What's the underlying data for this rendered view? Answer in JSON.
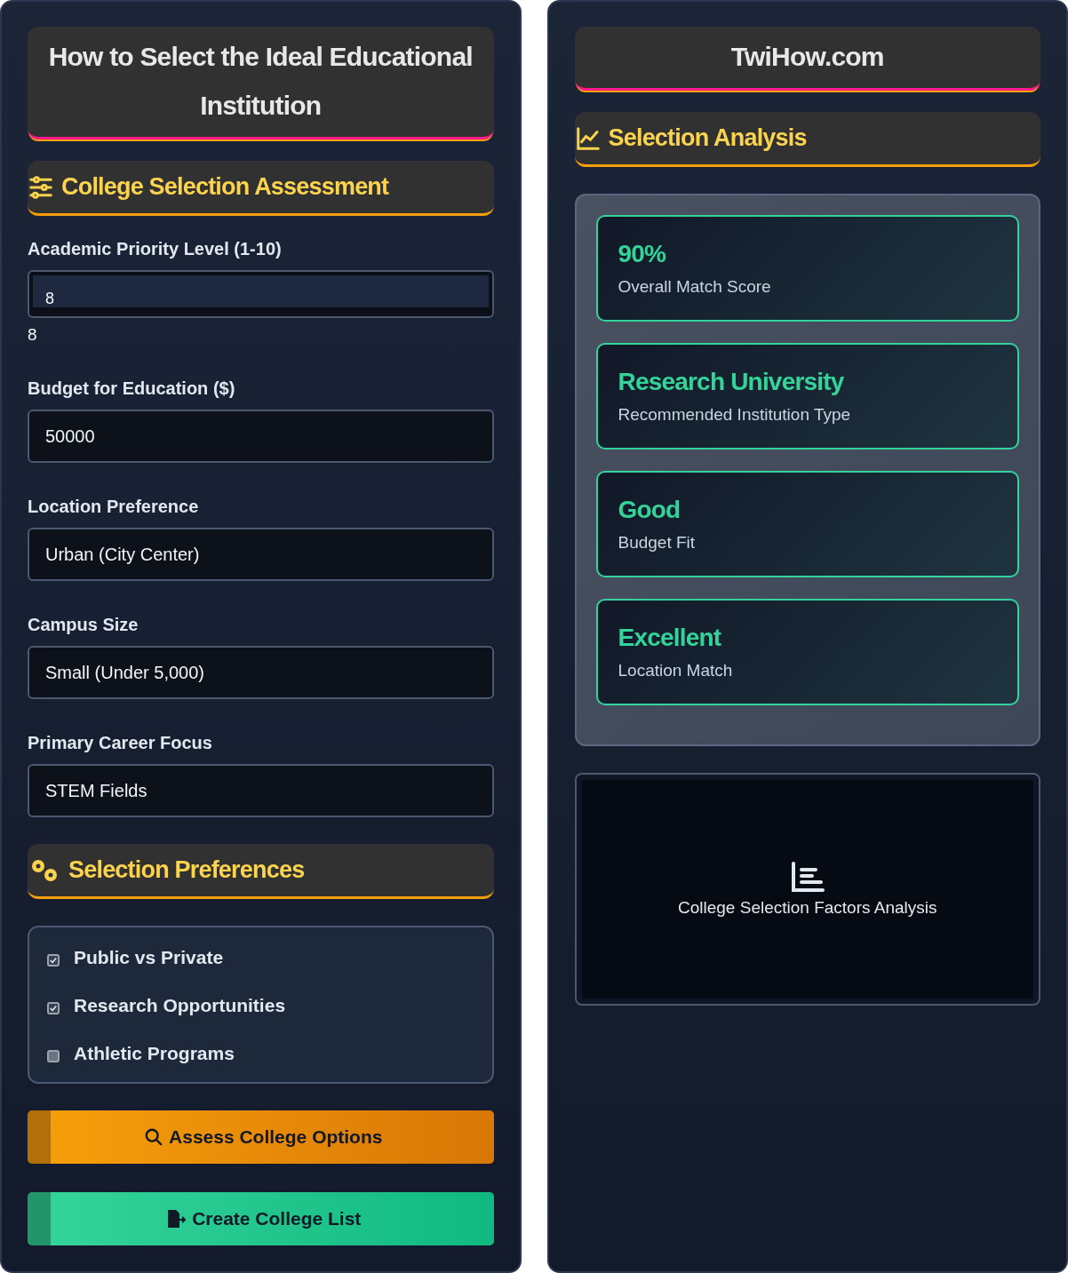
{
  "left_panel": {
    "title": "How to Select the Ideal Educational Institution",
    "assessment_header": "College Selection Assessment",
    "fields": [
      {
        "kind": "slider",
        "label": "Academic Priority Level (1-10)",
        "value": "8",
        "reading": "8"
      },
      {
        "kind": "input",
        "label": "Budget for Education ($)",
        "value": "50000"
      },
      {
        "kind": "select",
        "label": "Location Preference",
        "value": "Urban (City Center)"
      },
      {
        "kind": "select",
        "label": "Campus Size",
        "value": "Small (Under 5,000)"
      },
      {
        "kind": "select",
        "label": "Primary Career Focus",
        "value": "STEM Fields"
      }
    ],
    "preferences_header": "Selection Preferences",
    "preferences": [
      {
        "label": "Public vs Private",
        "checked": true
      },
      {
        "label": "Research Opportunities",
        "checked": true
      },
      {
        "label": "Athletic Programs",
        "checked": false
      }
    ],
    "buttons": [
      {
        "kind": "assess",
        "label": "Assess College Options"
      },
      {
        "kind": "create",
        "label": "Create College List"
      }
    ]
  },
  "right_panel": {
    "title": "TwiHow.com",
    "analysis_header": "Selection Analysis",
    "results": [
      {
        "value": "90%",
        "label": "Overall Match Score"
      },
      {
        "value": "Research University",
        "label": "Recommended Institution Type"
      },
      {
        "value": "Good",
        "label": "Budget Fit"
      },
      {
        "value": "Excellent",
        "label": "Location Match"
      }
    ],
    "chart_placeholder": "College Selection Factors Analysis"
  }
}
